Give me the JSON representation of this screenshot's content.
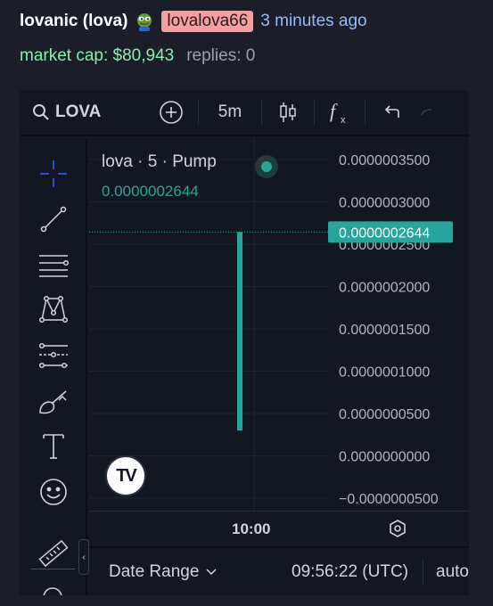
{
  "header": {
    "name": "lovanic (lova)",
    "creator": "lovalova66",
    "time_ago": "3 minutes ago",
    "market_cap": "market cap: $80,943",
    "replies": "replies: 0"
  },
  "toolbar": {
    "symbol": "LOVA",
    "interval": "5m",
    "icons": [
      "search-icon",
      "add-icon",
      "candles-icon",
      "function-icon",
      "undo-icon"
    ]
  },
  "left_tools": [
    "crosshair-icon",
    "trendline-icon",
    "fib-lines-icon",
    "pattern-icon",
    "forecast-icon",
    "brush-icon",
    "text-icon",
    "emoji-icon",
    "ruler-icon"
  ],
  "legend": {
    "title": "lova · 5 · Pump",
    "price": "0.0000002644"
  },
  "colors": {
    "up": "#26a69a",
    "badge": "#f5a0a0",
    "market_cap": "#86efac",
    "time": "#93bbf6"
  },
  "chart_data": {
    "type": "candlestick",
    "y_ticks": [
      "0.0000003500",
      "0.0000003000",
      "0.0000002500",
      "0.0000002000",
      "0.0000001500",
      "0.0000001000",
      "0.0000000500",
      "0.0000000000",
      "−0.0000000500"
    ],
    "ylim": [
      -5e-08,
      3.5e-07
    ],
    "x_tick": "10:00",
    "current_price_label": "0.0000002644",
    "current_price": 2.644e-07,
    "candles": [
      {
        "time": "09:55",
        "open": 3e-08,
        "high": 2.644e-07,
        "low": 3e-08,
        "close": 2.644e-07
      }
    ]
  },
  "bottom": {
    "date_range": "Date Range",
    "time_utc": "09:56:22 (UTC)",
    "auto": "auto"
  }
}
